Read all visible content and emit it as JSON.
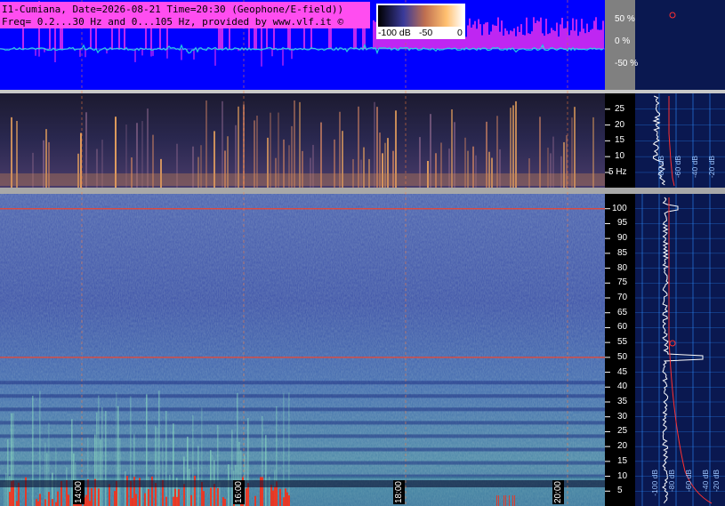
{
  "header": {
    "line1": "I1-Cumiana, Date=2026-08-21 Time=20:30 (Geophone/E-field))",
    "line2": "Freq= 0.2...30 Hz and 0...105 Hz, provided by www.vlf.it ©"
  },
  "colorbar": {
    "ticks": [
      "-100 dB",
      "-50",
      "0"
    ]
  },
  "colors": {
    "background": "#000000",
    "amplitude_bg": "#0000ff",
    "amplitude_pos": "#ff33ee",
    "amplitude_trace": "#20d0e0",
    "spectrogram_low": "#1e2a8c",
    "spectrogram_mid": "#3fa0a0",
    "spectrogram_high": "#ff9a40",
    "marker_line": "#ff4020",
    "profile_panel": "#0a1850",
    "grid": "#2a8cff"
  },
  "chart_data": [
    {
      "type": "line",
      "panel": "amplitude",
      "y_ticks": [
        "50 %",
        "0 %",
        "-50 %"
      ],
      "ylim": [
        -100,
        100
      ]
    },
    {
      "type": "heatmap",
      "panel": "spectrogram-low",
      "y_ticks": [
        "25",
        "20",
        "15",
        "10",
        "5 Hz"
      ],
      "ylim": [
        0.2,
        30
      ],
      "profile_db_ticks": [
        "-80 dB",
        "-60 dB",
        "-40 dB",
        "-20 dB"
      ]
    },
    {
      "type": "heatmap",
      "panel": "spectrogram-high",
      "y_ticks": [
        "100",
        "95",
        "90",
        "85",
        "80",
        "75",
        "70",
        "65",
        "60",
        "55",
        "50",
        "45",
        "40",
        "35",
        "30",
        "25",
        "20",
        "15",
        "10",
        "5"
      ],
      "ylim": [
        0,
        105
      ],
      "x_ticks": [
        "14:00",
        "16:00",
        "18:00",
        "20:00"
      ],
      "marker_lines_hz": [
        100,
        50
      ],
      "profile_db_ticks": [
        "-100 dB",
        "-80 dB",
        "-60 dB",
        "-40 dB",
        "-20 dB"
      ]
    }
  ]
}
